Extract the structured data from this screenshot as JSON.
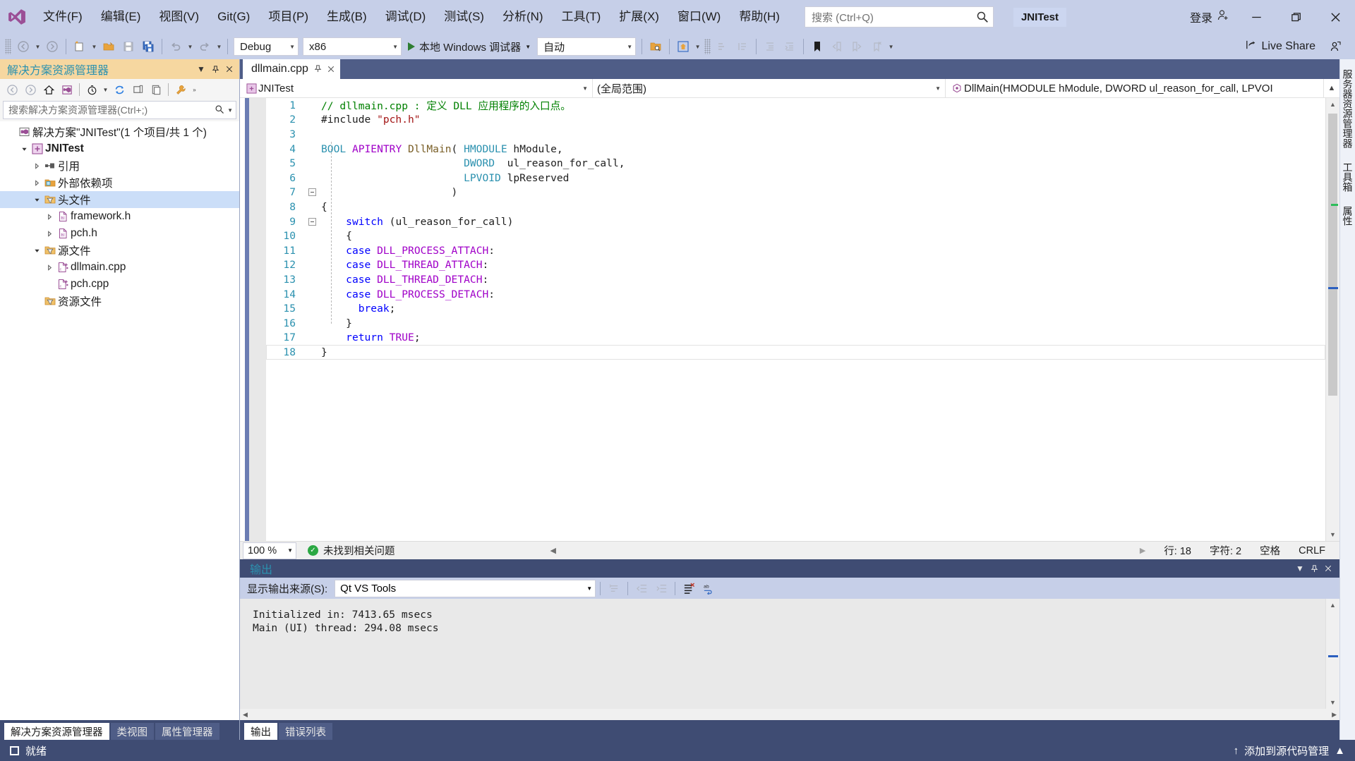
{
  "titlebar": {
    "menus": [
      {
        "label": "文件(F)"
      },
      {
        "label": "编辑(E)"
      },
      {
        "label": "视图(V)"
      },
      {
        "label": "Git(G)"
      },
      {
        "label": "项目(P)"
      },
      {
        "label": "生成(B)"
      },
      {
        "label": "调试(D)"
      },
      {
        "label": "测试(S)"
      },
      {
        "label": "分析(N)"
      },
      {
        "label": "工具(T)"
      },
      {
        "label": "扩展(X)"
      },
      {
        "label": "窗口(W)"
      },
      {
        "label": "帮助(H)"
      }
    ],
    "search_placeholder": "搜索 (Ctrl+Q)",
    "project_chip": "JNITest",
    "signin": "登录",
    "minimize": "—",
    "restore": "❐",
    "close": "✕"
  },
  "toolbar": {
    "configuration": "Debug",
    "platform": "x86",
    "run_label": "本地 Windows 调试器",
    "attach_mode": "自动",
    "live_share": "Live Share"
  },
  "solution_explorer": {
    "title": "解决方案资源管理器",
    "search_placeholder": "搜索解决方案资源管理器(Ctrl+;)",
    "tree": [
      {
        "label": "解决方案\"JNITest\"(1 个项目/共 1 个)",
        "indent": 0,
        "expander": "none",
        "icon": "solution-icon",
        "bold": false,
        "selected": false
      },
      {
        "label": "JNITest",
        "indent": 1,
        "expander": "expanded",
        "icon": "project-icon",
        "bold": true,
        "selected": false
      },
      {
        "label": "引用",
        "indent": 2,
        "expander": "collapsed",
        "icon": "references-icon",
        "bold": false,
        "selected": false
      },
      {
        "label": "外部依赖项",
        "indent": 2,
        "expander": "collapsed",
        "icon": "ext-deps-icon",
        "bold": false,
        "selected": false
      },
      {
        "label": "头文件",
        "indent": 2,
        "expander": "expanded",
        "icon": "filter-folder-icon",
        "bold": false,
        "selected": true
      },
      {
        "label": "framework.h",
        "indent": 3,
        "expander": "collapsed",
        "icon": "header-file-icon",
        "bold": false,
        "selected": false
      },
      {
        "label": "pch.h",
        "indent": 3,
        "expander": "collapsed",
        "icon": "header-file-icon",
        "bold": false,
        "selected": false
      },
      {
        "label": "源文件",
        "indent": 2,
        "expander": "expanded",
        "icon": "filter-folder-icon",
        "bold": false,
        "selected": false
      },
      {
        "label": "dllmain.cpp",
        "indent": 3,
        "expander": "collapsed",
        "icon": "cpp-file-icon",
        "bold": false,
        "selected": false
      },
      {
        "label": "pch.cpp",
        "indent": 3,
        "expander": "none",
        "icon": "cpp-file-icon",
        "bold": false,
        "selected": false
      },
      {
        "label": "资源文件",
        "indent": 2,
        "expander": "none",
        "icon": "filter-folder-icon",
        "bold": false,
        "selected": false
      }
    ],
    "bottom_tabs": [
      {
        "label": "解决方案资源管理器",
        "active": true
      },
      {
        "label": "类视图",
        "active": false
      },
      {
        "label": "属性管理器",
        "active": false
      }
    ]
  },
  "editor": {
    "tab_label": "dllmain.cpp",
    "nav_project": "JNITest",
    "nav_scope": "(全局范围)",
    "nav_member": "DllMain(HMODULE hModule, DWORD ul_reason_for_call, LPVOI",
    "zoom": "100 %",
    "issues": "未找到相关问题",
    "status_line": "行: 18",
    "status_col": "字符: 2",
    "status_space": "空格",
    "status_eol": "CRLF",
    "code_lines": [
      {
        "n": "1",
        "fold": "",
        "tokens": [
          {
            "t": "// dllmain.cpp : 定义 DLL 应用程序的入口点。",
            "c": "c"
          }
        ]
      },
      {
        "n": "2",
        "fold": "",
        "tokens": [
          {
            "t": "#include ",
            "c": "p"
          },
          {
            "t": "\"pch.h\"",
            "c": "s"
          }
        ]
      },
      {
        "n": "3",
        "fold": "",
        "tokens": []
      },
      {
        "n": "4",
        "fold": "",
        "tokens": [
          {
            "t": "BOOL ",
            "c": "t"
          },
          {
            "t": "APIENTRY ",
            "c": "m"
          },
          {
            "t": "DllMain",
            "c": "fn"
          },
          {
            "t": "( ",
            "c": "p"
          },
          {
            "t": "HMODULE ",
            "c": "t"
          },
          {
            "t": "hModule,",
            "c": "p"
          }
        ]
      },
      {
        "n": "5",
        "fold": "",
        "tokens": [
          {
            "t": "                       ",
            "c": "p"
          },
          {
            "t": "DWORD",
            "c": "t"
          },
          {
            "t": "  ul_reason_for_call,",
            "c": "p"
          }
        ]
      },
      {
        "n": "6",
        "fold": "",
        "tokens": [
          {
            "t": "                       ",
            "c": "p"
          },
          {
            "t": "LPVOID ",
            "c": "t"
          },
          {
            "t": "lpReserved",
            "c": "p"
          }
        ]
      },
      {
        "n": "7",
        "fold": "minus",
        "tokens": [
          {
            "t": "                     )",
            "c": "p"
          }
        ]
      },
      {
        "n": "8",
        "fold": "bar",
        "tokens": [
          {
            "t": "{",
            "c": "p"
          }
        ]
      },
      {
        "n": "9",
        "fold": "minus",
        "tokens": [
          {
            "t": "    ",
            "c": "p"
          },
          {
            "t": "switch",
            "c": "k"
          },
          {
            "t": " (ul_reason_for_call)",
            "c": "p"
          }
        ]
      },
      {
        "n": "10",
        "fold": "bar",
        "tokens": [
          {
            "t": "    {",
            "c": "p"
          }
        ]
      },
      {
        "n": "11",
        "fold": "bar",
        "tokens": [
          {
            "t": "    ",
            "c": "p"
          },
          {
            "t": "case",
            "c": "k"
          },
          {
            "t": " ",
            "c": "p"
          },
          {
            "t": "DLL_PROCESS_ATTACH",
            "c": "m"
          },
          {
            "t": ":",
            "c": "p"
          }
        ]
      },
      {
        "n": "12",
        "fold": "bar",
        "tokens": [
          {
            "t": "    ",
            "c": "p"
          },
          {
            "t": "case",
            "c": "k"
          },
          {
            "t": " ",
            "c": "p"
          },
          {
            "t": "DLL_THREAD_ATTACH",
            "c": "m"
          },
          {
            "t": ":",
            "c": "p"
          }
        ]
      },
      {
        "n": "13",
        "fold": "bar",
        "tokens": [
          {
            "t": "    ",
            "c": "p"
          },
          {
            "t": "case",
            "c": "k"
          },
          {
            "t": " ",
            "c": "p"
          },
          {
            "t": "DLL_THREAD_DETACH",
            "c": "m"
          },
          {
            "t": ":",
            "c": "p"
          }
        ]
      },
      {
        "n": "14",
        "fold": "bar",
        "tokens": [
          {
            "t": "    ",
            "c": "p"
          },
          {
            "t": "case",
            "c": "k"
          },
          {
            "t": " ",
            "c": "p"
          },
          {
            "t": "DLL_PROCESS_DETACH",
            "c": "m"
          },
          {
            "t": ":",
            "c": "p"
          }
        ]
      },
      {
        "n": "15",
        "fold": "bar",
        "tokens": [
          {
            "t": "      ",
            "c": "p"
          },
          {
            "t": "break",
            "c": "k"
          },
          {
            "t": ";",
            "c": "p"
          }
        ]
      },
      {
        "n": "16",
        "fold": "bar",
        "tokens": [
          {
            "t": "    }",
            "c": "p"
          }
        ]
      },
      {
        "n": "17",
        "fold": "bar",
        "tokens": [
          {
            "t": "    ",
            "c": "p"
          },
          {
            "t": "return",
            "c": "k"
          },
          {
            "t": " ",
            "c": "p"
          },
          {
            "t": "TRUE",
            "c": "m"
          },
          {
            "t": ";",
            "c": "p"
          }
        ]
      },
      {
        "n": "18",
        "fold": "end",
        "tokens": [
          {
            "t": "}",
            "c": "p"
          }
        ]
      }
    ]
  },
  "output": {
    "title": "输出",
    "source_label": "显示输出来源(S):",
    "source_value": "Qt VS Tools",
    "lines": [
      "Initialized in: 7413.65 msecs",
      "Main (UI) thread: 294.08 msecs"
    ],
    "tabs": [
      {
        "label": "输出",
        "active": true
      },
      {
        "label": "错误列表",
        "active": false
      }
    ]
  },
  "right_dock": {
    "tabs": [
      "服务器资源管理器",
      "工具箱",
      "属性"
    ]
  },
  "statusbar": {
    "ready": "就绪",
    "source_control": "添加到源代码管理"
  },
  "colors": {
    "chrome": "#c6cfe8",
    "accent_dark": "#3f4c73",
    "sln_header": "#f6d7a0",
    "selection": "#cbdef8",
    "comment_green": "#008000",
    "keyword_blue": "#0000ff",
    "macro_purple": "#a000c8",
    "type_teal": "#2b91af",
    "string_red": "#a31515"
  }
}
